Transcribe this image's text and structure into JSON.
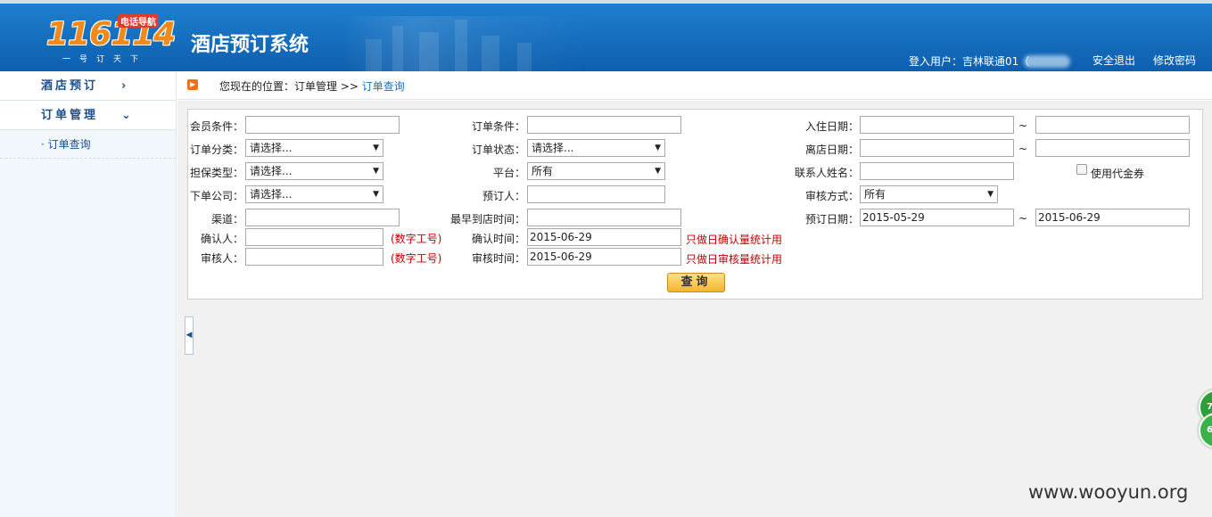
{
  "header": {
    "logo_text": "116114",
    "logo_tag": "电话导航",
    "logo_sub": "一号订天下",
    "title": "酒店预订系统",
    "user_label": "登入用户：吉林联通01（",
    "logout_label": "安全退出",
    "change_password_label": "修改密码"
  },
  "sidebar": {
    "items": [
      {
        "label": "酒店预订",
        "chevron": "›"
      },
      {
        "label": "订单管理",
        "chevron": "⌄"
      }
    ],
    "subitems": [
      {
        "label": "· 订单查询"
      }
    ]
  },
  "breadcrumb": {
    "prefix": "您现在的位置：订单管理 >> ",
    "current": "订单查询"
  },
  "form": {
    "member_condition": {
      "label": "会员条件：",
      "value": ""
    },
    "order_condition": {
      "label": "订单条件：",
      "value": ""
    },
    "checkin_date": {
      "label": "入住日期：",
      "from": "",
      "to": ""
    },
    "order_category": {
      "label": "订单分类：",
      "value": "请选择..."
    },
    "order_status": {
      "label": "订单状态：",
      "value": "请选择..."
    },
    "checkout_date": {
      "label": "离店日期：",
      "from": "",
      "to": ""
    },
    "guarantee_type": {
      "label": "担保类型：",
      "value": "请选择..."
    },
    "platform": {
      "label": "平台：",
      "value": "所有"
    },
    "contact_name": {
      "label": "联系人姓名：",
      "value": ""
    },
    "voucher": {
      "label": "使用代金券"
    },
    "order_company": {
      "label": "下单公司：",
      "value": "请选择..."
    },
    "booker": {
      "label": "预订人：",
      "value": ""
    },
    "review_method": {
      "label": "审核方式：",
      "value": "所有"
    },
    "channel": {
      "label": "渠道：",
      "value": ""
    },
    "earliest_arrival": {
      "label": "最早到店时间：",
      "value": ""
    },
    "booking_date": {
      "label": "预订日期：",
      "from": "2015-05-29",
      "to": "2015-06-29"
    },
    "confirmer": {
      "label": "确认人：",
      "value": "",
      "hint": "(数字工号)"
    },
    "confirm_time": {
      "label": "确认时间：",
      "value": "2015-06-29",
      "hint": "只做日确认量统计用"
    },
    "reviewer": {
      "label": "审核人：",
      "value": "",
      "hint": "(数字工号)"
    },
    "review_time": {
      "label": "审核时间：",
      "value": "2015-06-29",
      "hint": "只做日审核量统计用"
    },
    "tilde": "~",
    "query_button": "查询"
  },
  "floating": {
    "ball1": "7",
    "ball2": "68"
  },
  "watermark": "www.wooyun.org",
  "colors": {
    "header": "#1670c4",
    "sidebar": "#f1f7fd",
    "menu_text": "#1b4f8c",
    "hint_red": "#c00000",
    "button": "#f5b52e"
  },
  "icons": {
    "breadcrumb": "arrow-box-icon",
    "collapse": "caret-left-icon",
    "select": "caret-down-icon"
  }
}
